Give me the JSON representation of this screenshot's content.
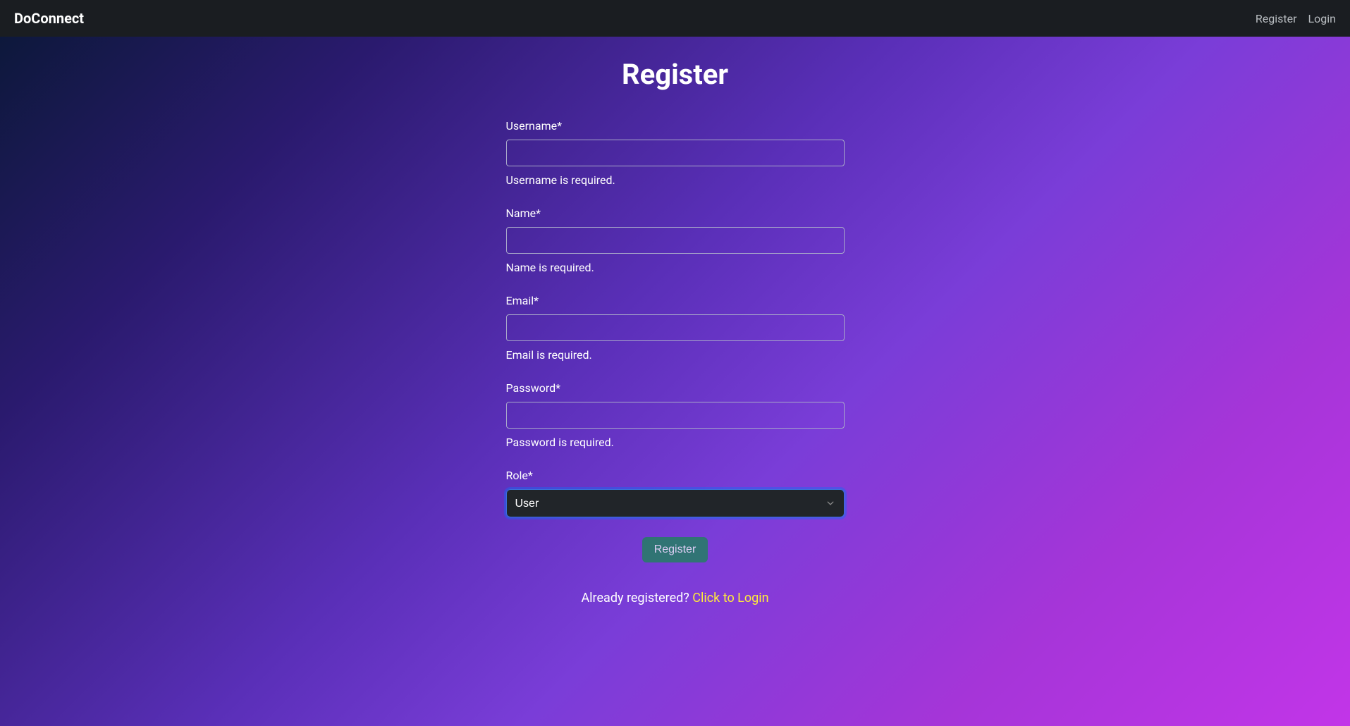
{
  "navbar": {
    "brand": "DoConnect",
    "links": {
      "register": "Register",
      "login": "Login"
    }
  },
  "page": {
    "title": "Register"
  },
  "form": {
    "username": {
      "label": "Username*",
      "value": "",
      "error": "Username is required."
    },
    "name": {
      "label": "Name*",
      "value": "",
      "error": "Name is required."
    },
    "email": {
      "label": "Email*",
      "value": "",
      "error": "Email is required."
    },
    "password": {
      "label": "Password*",
      "value": "",
      "error": "Password is required."
    },
    "role": {
      "label": "Role*",
      "selected": "User"
    },
    "submit_label": "Register"
  },
  "footer": {
    "prompt": "Already registered? ",
    "link_text": "Click to Login"
  }
}
